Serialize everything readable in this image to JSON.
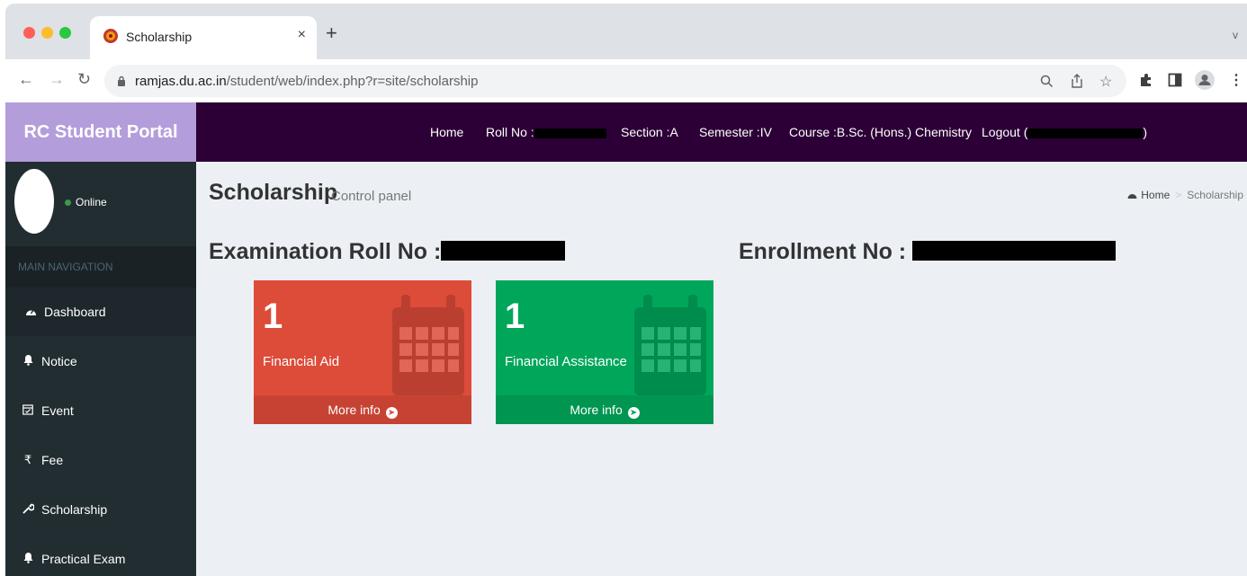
{
  "browser": {
    "tab_title": "Scholarship",
    "tab_close": "×",
    "new_tab": "+",
    "tab_menu": "v",
    "url_host": "ramjas.du.ac.in",
    "url_path": "/student/web/index.php?r=site/scholarship"
  },
  "portal": {
    "logo": "RC Student Portal",
    "nav": {
      "home": "Home",
      "roll_label": "Roll No :",
      "section": "Section :A",
      "semester": "Semester :IV",
      "course": "Course :B.Sc. (Hons.) Chemistry",
      "logout_prefix": "Logout (",
      "logout_suffix": ")"
    }
  },
  "sidebar": {
    "status": "Online",
    "header": "MAIN NAVIGATION",
    "items": [
      {
        "label": "Dashboard",
        "icon": "dashboard-icon"
      },
      {
        "label": "Notice",
        "icon": "bell-icon"
      },
      {
        "label": "Event",
        "icon": "calendar-icon"
      },
      {
        "label": "Fee",
        "icon": "rupee-icon"
      },
      {
        "label": "Scholarship",
        "icon": "wrench-icon"
      },
      {
        "label": "Practical Exam",
        "icon": "bell-icon"
      }
    ]
  },
  "content": {
    "title": "Scholarship",
    "subtitle": "Control panel",
    "breadcrumb": {
      "home": "Home",
      "current": "Scholarship"
    },
    "exam_roll_label": "Examination Roll No :",
    "enrollment_label": "Enrollment No :",
    "boxes": [
      {
        "count": "1",
        "label": "Financial Aid",
        "footer": "More info",
        "color": "#dd4b39"
      },
      {
        "count": "1",
        "label": "Financial Assistance",
        "footer": "More info",
        "color": "#00a65a"
      }
    ]
  },
  "colors": {
    "topbar": "#2c0036",
    "logo_bg": "#b39ddb",
    "sidebar": "#222d32",
    "content_bg": "#ecf0f5"
  }
}
